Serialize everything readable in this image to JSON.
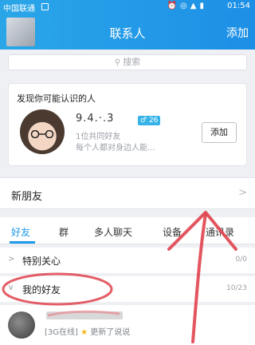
{
  "statusbar": {
    "carrier": "中国联通",
    "time": "01:54",
    "icons": [
      "alarm-icon",
      "mute-icon",
      "signal-icon",
      "battery-icon"
    ]
  },
  "titlebar": {
    "title": "联系人",
    "add_label": "添加"
  },
  "search": {
    "placeholder": "搜索"
  },
  "suggestion": {
    "heading": "发现你可能认识的人",
    "name": "9.4.·.3",
    "level": "26",
    "mutual": "1位共同好友",
    "tagline": "每个人都对身边人能...",
    "add_label": "添加"
  },
  "new_friends": {
    "label": "新朋友"
  },
  "tabs": [
    {
      "label": "好友",
      "active": true
    },
    {
      "label": "群"
    },
    {
      "label": "多人聊天"
    },
    {
      "label": "设备"
    },
    {
      "label": "通讯录"
    }
  ],
  "groups": [
    {
      "label": "特别关心",
      "count": "0/0"
    },
    {
      "label": "我的好友",
      "count": "10/23"
    }
  ],
  "contact": {
    "status_tag": "[3G在线]",
    "status_text": "更新了说说"
  },
  "colors": {
    "header": "#1d8fe6",
    "accent": "#1f9ae8",
    "annotation": "#e0434e"
  }
}
